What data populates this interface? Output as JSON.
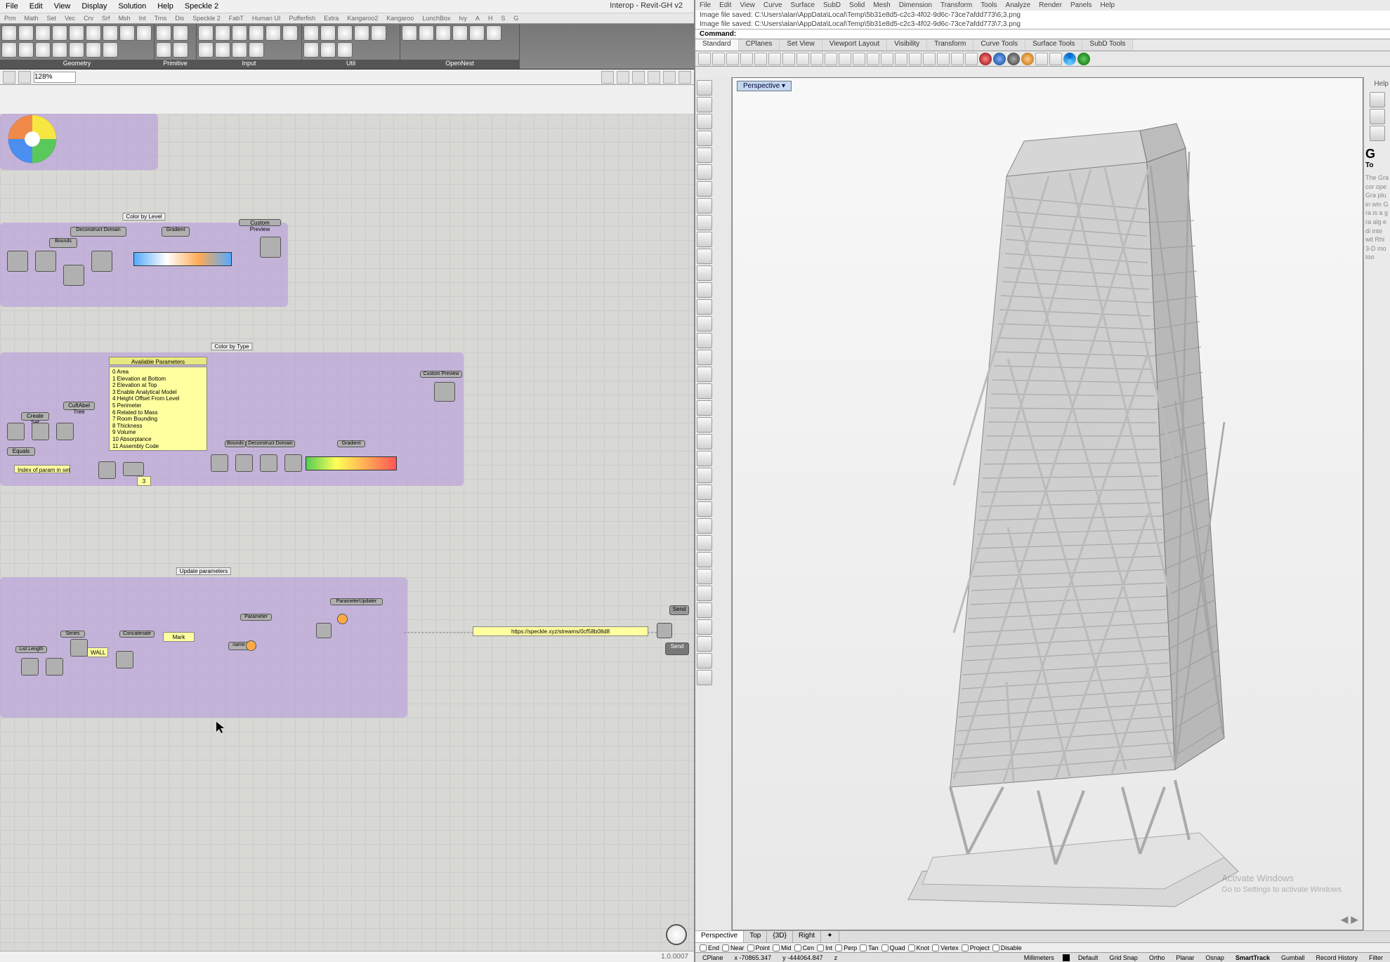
{
  "gh": {
    "title": "Interop - Revit-GH v2",
    "menu": [
      "File",
      "Edit",
      "View",
      "Display",
      "Solution",
      "Help",
      "Speckle 2"
    ],
    "tabs": [
      "Prm",
      "Math",
      "Set",
      "Vec",
      "Crv",
      "Srf",
      "Msh",
      "Int",
      "Trns",
      "Dis",
      "Speckle 2",
      "FabT",
      "Human UI",
      "Pufferfish",
      "Extra",
      "Kangaroo2",
      "Kangaroo",
      "LunchBox",
      "Ivy",
      "A",
      "H",
      "S",
      "G"
    ],
    "ribbon_panels": [
      "Geometry",
      "Primitive",
      "Input",
      "Util",
      "OpenNest"
    ],
    "zoom": "128%",
    "groups": {
      "g1": "Color by Level",
      "g1a": "Custom Preview",
      "g1b": "Bounds",
      "g1c": "Deconstruct Domain",
      "g1d": "Gradient",
      "g2": "Color by Type",
      "g2a": "Available Parameters",
      "g2b": "Custom Preview",
      "g2c": "Bounds",
      "g2d": "Deconstruct Domain",
      "g2e": "Gradient",
      "g3": "Update parameters",
      "g3a": "ParameterUpdater",
      "g3b": "Parameter",
      "g3c": "Concatenate",
      "g3d": "Series",
      "g3e": "List Length",
      "g3f_btn1": "Send",
      "g3f_btn2": "Send"
    },
    "nodes": {
      "create_set": "Create Set",
      "walls": "WALL",
      "mark": "Mark",
      "cuftabel": "CuftAbel Tree",
      "equals": "Equals",
      "name": "name"
    },
    "panels": {
      "params_list": "0 Area\n1 Elevation at Bottom\n2 Elevation at Top\n3 Enable Analytical Model\n4 Height Offset From Level\n5 Perimeter\n6 Related to Mass\n7 Room Bounding\n8 Thickness\n9 Volume\n10 Absorptance\n11 Assembly Code",
      "index_panel": "Index of param in set",
      "url_panel": "https://speckle.xyz/streams/0cf58b08d8",
      "number_panel": "3"
    },
    "version": "1.0.0007"
  },
  "rh": {
    "menu": [
      "File",
      "Edit",
      "View",
      "Curve",
      "Surface",
      "SubD",
      "Solid",
      "Mesh",
      "Dimension",
      "Transform",
      "Tools",
      "Analyze",
      "Render",
      "Panels",
      "Help"
    ],
    "cmd_hist1": "Image file saved: C:\\Users\\alan\\AppData\\Local\\Temp\\5b31e8d5-c2c3-4f02-9d6c-73ce7afdd773\\6;3.png",
    "cmd_hist2": "Image file saved: C:\\Users\\alan\\AppData\\Local\\Temp\\5b31e8d5-c2c3-4f02-9d6c-73ce7afdd773\\7;3.png",
    "cmd_label": "Command:",
    "tabs": [
      "Standard",
      "CPlanes",
      "Set View",
      "Viewport Layout",
      "Visibility",
      "Transform",
      "Curve Tools",
      "Surface Tools",
      "SubD Tools"
    ],
    "viewport_label": "Perspective",
    "btabs": [
      "Perspective",
      "Top",
      "{3D}",
      "Right"
    ],
    "osnap": [
      "End",
      "Near",
      "Point",
      "Mid",
      "Cen",
      "Int",
      "Perp",
      "Tan",
      "Quad",
      "Knot",
      "Vertex",
      "Project",
      "Disable"
    ],
    "status": {
      "cplane": "CPlane",
      "x": "x -70865.347",
      "y": "y -444064.847",
      "z": "z",
      "units": "Millimeters",
      "layer": "Default",
      "items": [
        "Grid Snap",
        "Ortho",
        "Planar",
        "Osnap",
        "SmartTrack",
        "Gumball",
        "Record History",
        "Filter"
      ]
    },
    "help_label": "Help",
    "sidebar_title": "G",
    "sidebar_sub": "To",
    "watermark1": "Activate Windows",
    "watermark2": "Go to Settings to activate Windows"
  }
}
